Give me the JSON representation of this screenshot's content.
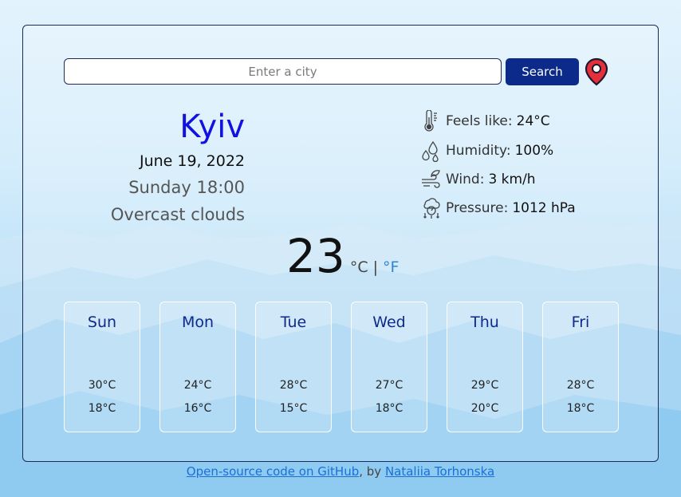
{
  "search": {
    "placeholder": "Enter a city",
    "button_label": "Search"
  },
  "current": {
    "city": "Kyiv",
    "date": "June 19, 2022",
    "day_time": "Sunday 18:00",
    "description": "Overcast clouds",
    "temperature": "23",
    "unit_celsius": "°C",
    "unit_separator": "|",
    "unit_fahrenheit": "°F"
  },
  "details": [
    {
      "icon": "thermometer-icon",
      "label": "Feels like:",
      "value": "24°C"
    },
    {
      "icon": "humidity-drops-icon",
      "label": "Humidity:",
      "value": "100%"
    },
    {
      "icon": "wind-icon",
      "label": "Wind:",
      "value": "3 km/h"
    },
    {
      "icon": "pressure-gauge-icon",
      "label": "Pressure:",
      "value": "1012 hPa"
    }
  ],
  "forecast": [
    {
      "day": "Sun",
      "max": "30°C",
      "min": "18°C"
    },
    {
      "day": "Mon",
      "max": "24°C",
      "min": "16°C"
    },
    {
      "day": "Tue",
      "max": "28°C",
      "min": "15°C"
    },
    {
      "day": "Wed",
      "max": "27°C",
      "min": "18°C"
    },
    {
      "day": "Thu",
      "max": "29°C",
      "min": "20°C"
    },
    {
      "day": "Fri",
      "max": "28°C",
      "min": "18°C"
    }
  ],
  "footer": {
    "link1": "Open-source code on GitHub",
    "by_text": ", by ",
    "link2": "Nataliia Torhonska"
  },
  "colors": {
    "city": "#1212e0",
    "search_button": "#0b2a8a",
    "fahrenheit_link": "#2b86d8",
    "forecast_day": "#0f2a8a",
    "location_pin": "#e5303c"
  }
}
